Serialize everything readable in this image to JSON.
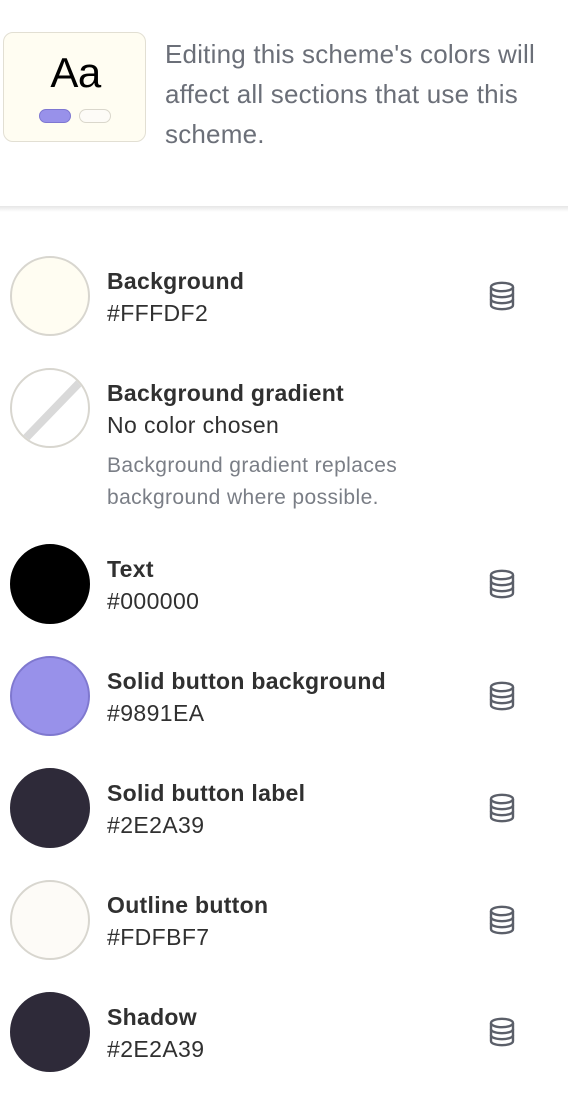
{
  "preview": {
    "sample_text": "Aa"
  },
  "description": "Editing this scheme's colors will affect all sections that use this scheme.",
  "colors": [
    {
      "name": "Background",
      "value": "#FFFDF2",
      "swatch": "#FFFDF2",
      "icon": "database-icon"
    },
    {
      "name": "Background gradient",
      "value": "No color chosen",
      "help": "Background gradient replaces background where possible."
    },
    {
      "name": "Text",
      "value": "#000000",
      "swatch": "#000000",
      "icon": "database-icon"
    },
    {
      "name": "Solid button background",
      "value": "#9891EA",
      "swatch": "#9891EA",
      "icon": "database-icon"
    },
    {
      "name": "Solid button label",
      "value": "#2E2A39",
      "swatch": "#2E2A39",
      "icon": "database-icon"
    },
    {
      "name": "Outline button",
      "value": "#FDFBF7",
      "swatch": "#FDFBF7",
      "icon": "database-icon"
    },
    {
      "name": "Shadow",
      "value": "#2E2A39",
      "swatch": "#2E2A39",
      "icon": "database-icon"
    }
  ]
}
